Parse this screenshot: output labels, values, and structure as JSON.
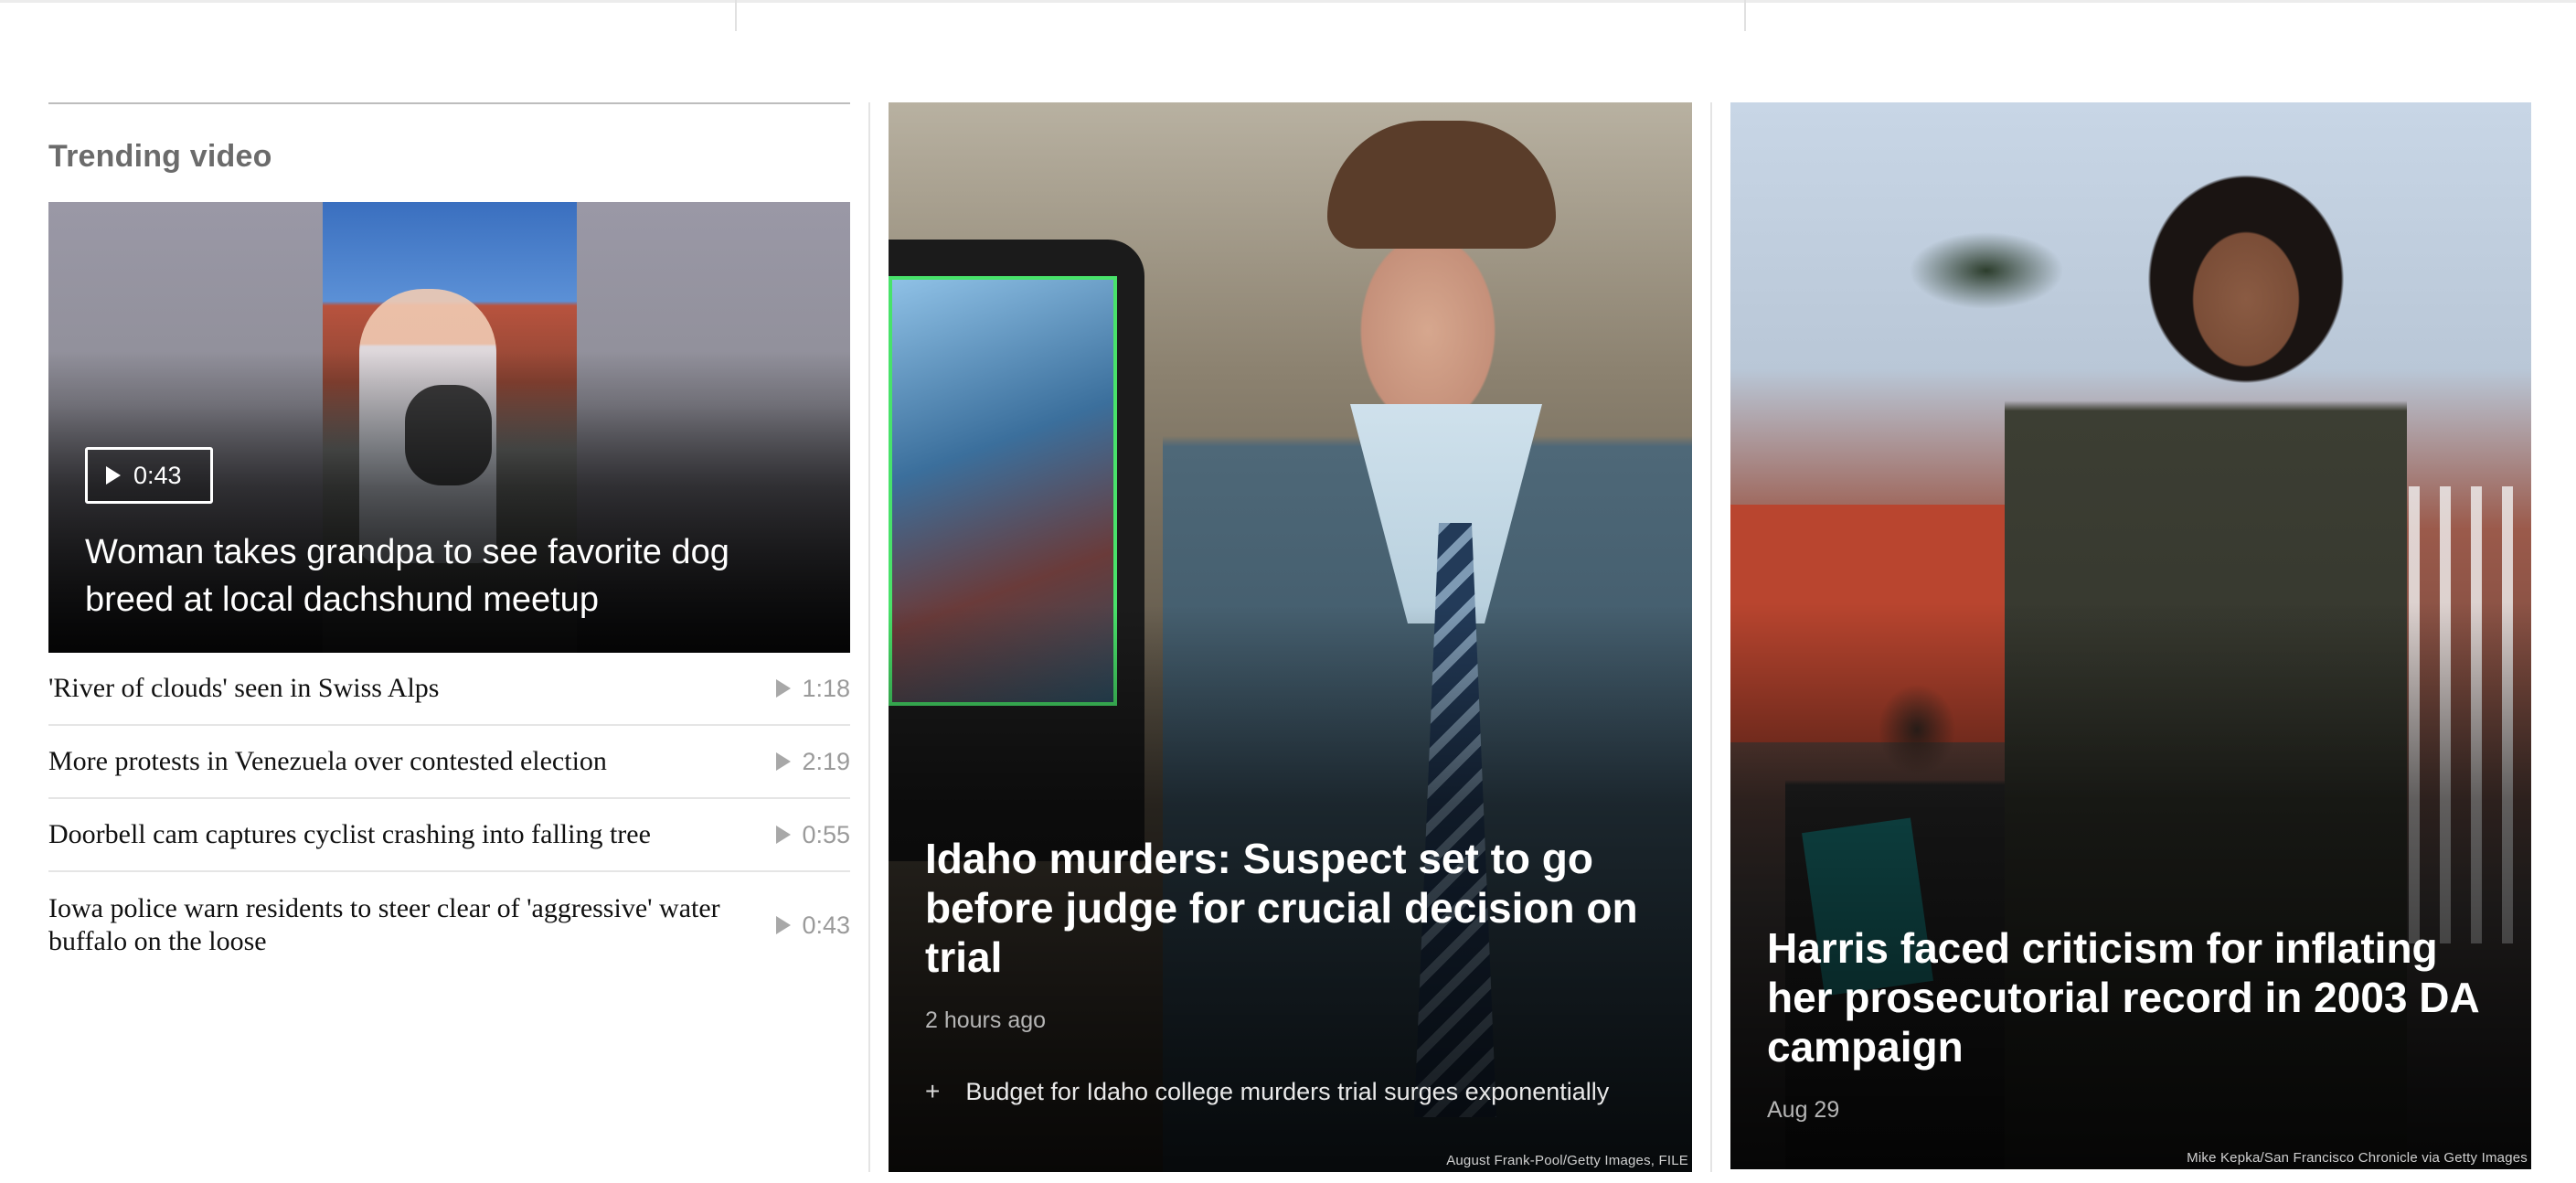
{
  "trending": {
    "section_title": "Trending video",
    "featured": {
      "duration": "0:43",
      "title": "Woman takes grandpa to see favorite dog breed at local dachshund meetup"
    },
    "items": [
      {
        "title": "'River of clouds' seen in Swiss Alps",
        "duration": "1:18"
      },
      {
        "title": "More protests in Venezuela over contested election",
        "duration": "2:19"
      },
      {
        "title": "Doorbell cam captures cyclist crashing into falling tree",
        "duration": "0:55"
      },
      {
        "title": "Iowa police warn residents to steer clear of 'aggressive' water buffalo on the loose",
        "duration": "0:43"
      }
    ]
  },
  "stories": [
    {
      "headline": "Idaho murders: Suspect set to go before judge for crucial decision on trial",
      "timestamp": "2 hours ago",
      "related_symbol": "+",
      "related": "Budget for Idaho college murders trial surges exponentially",
      "credit": "August Frank-Pool/Getty Images, FILE"
    },
    {
      "headline": "Harris faced criticism for inflating her prosecutorial record in 2003 DA campaign",
      "timestamp": "Aug 29",
      "credit": "Mike Kepka/San Francisco Chronicle via Getty Images"
    }
  ]
}
